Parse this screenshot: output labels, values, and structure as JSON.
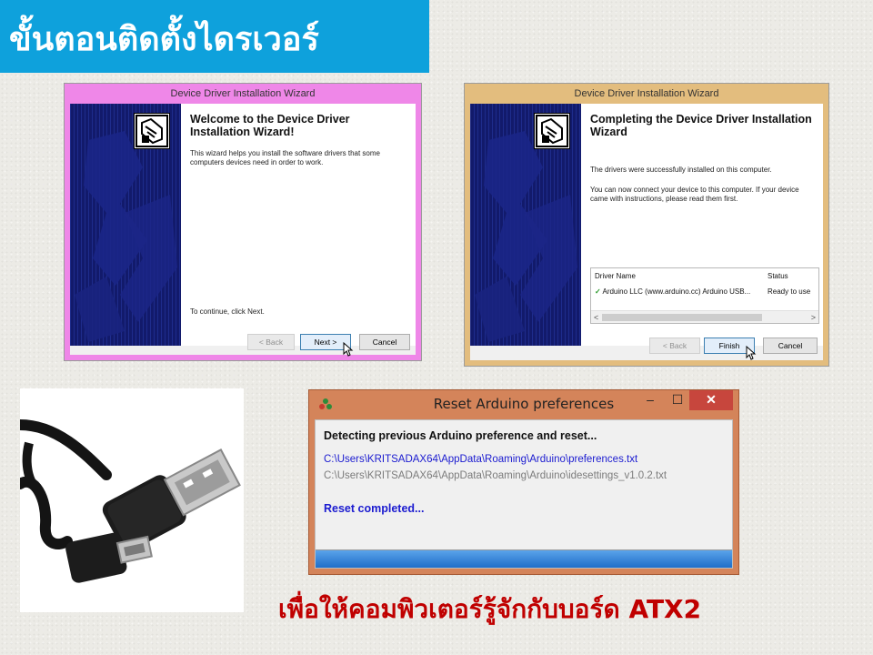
{
  "slide": {
    "title": "ขั้นตอนติดตั้งไดรเวอร์",
    "caption": "เพื่อให้คอมพิวเตอร์รู้จักกับบอร์ด ATX2",
    "colors": {
      "title_bar": "#0ea1dc",
      "caption": "#c00000"
    }
  },
  "wizard_welcome": {
    "window_title": "Device Driver Installation Wizard",
    "heading": "Welcome to the Device Driver Installation Wizard!",
    "body": "This wizard helps you install the software drivers that some computers devices need in order to work.",
    "footer_text": "To continue, click Next.",
    "buttons": {
      "back": "< Back",
      "next": "Next >",
      "cancel": "Cancel"
    },
    "frame_color": "#ef87e8"
  },
  "wizard_complete": {
    "window_title": "Device Driver Installation Wizard",
    "heading": "Completing the Device Driver Installation Wizard",
    "body1": "The drivers were successfully installed on this computer.",
    "body2": "You can now connect your device to this computer. If your device came with instructions, please read them first.",
    "table": {
      "headers": [
        "Driver Name",
        "Status"
      ],
      "rows": [
        {
          "name": "Arduino LLC (www.arduino.cc) Arduino USB...",
          "status": "Ready to use",
          "icon": "checkmark-icon"
        }
      ]
    },
    "buttons": {
      "back": "< Back",
      "finish": "Finish",
      "cancel": "Cancel"
    },
    "frame_color": "#e3bd7e"
  },
  "reset_dialog": {
    "title": "Reset Arduino preferences",
    "heading": "Detecting previous Arduino preference and reset...",
    "path1": "C:\\Users\\KRITSADAX64\\AppData\\Roaming\\Arduino\\preferences.txt",
    "path2": "C:\\Users\\KRITSADAX64\\AppData\\Roaming\\Arduino\\idesettings_v1.0.2.txt",
    "status": "Reset completed...",
    "controls": {
      "minimize": "‒",
      "maximize": "☐",
      "close": "✕"
    },
    "progress_percent": 100,
    "colors": {
      "frame": "#d4845a",
      "path_link": "#1b1bd0",
      "path_muted": "#7c7c7c",
      "close": "#c7463d"
    }
  },
  "usb_photo": {
    "icon": "usb-cable-photo"
  }
}
